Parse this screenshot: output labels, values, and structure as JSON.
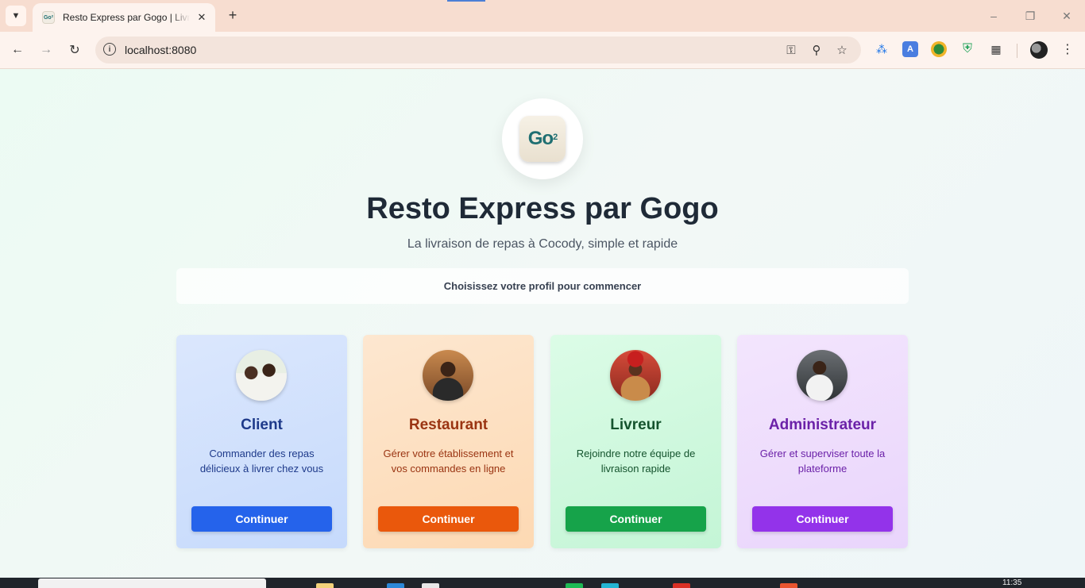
{
  "browser": {
    "tab_title": "Resto Express par Gogo | Livraison de repas à Cocody",
    "tab_favicon_text": "Go²",
    "tab_close_glyph": "✕",
    "new_tab_glyph": "+",
    "url": "localhost:8080",
    "icons": [
      "tab-search-icon",
      "back-icon",
      "forward-icon",
      "reload-icon",
      "site-info-icon",
      "password-key-icon",
      "zoom-icon",
      "bookmark-star-icon",
      "extension-wifi-icon",
      "extension-translate-icon",
      "extension-globe-icon",
      "extension-shield-icon",
      "extensions-puzzle-icon",
      "profile-avatar",
      "menu-kebab-icon"
    ]
  },
  "header": {
    "logo_text": "Go",
    "logo_sup": "2",
    "title": "Resto Express par Gogo",
    "subtitle": "La livraison de repas à Cocody, simple et rapide",
    "prompt": "Choisissez votre profil pour commencer"
  },
  "cards": [
    {
      "title": "Client",
      "description": "Commander des repas délicieux à livrer chez vous",
      "button": "Continuer",
      "accent": "#2563eb"
    },
    {
      "title": "Restaurant",
      "description": "Gérer votre établissement et vos commandes en ligne",
      "button": "Continuer",
      "accent": "#ea580c"
    },
    {
      "title": "Livreur",
      "description": "Rejoindre notre équipe de livraison rapide",
      "button": "Continuer",
      "accent": "#16a34a"
    },
    {
      "title": "Administrateur",
      "description": "Gérer et superviser toute la plateforme",
      "button": "Continuer",
      "accent": "#9333ea"
    }
  ],
  "taskbar": {
    "time": "11:35"
  }
}
